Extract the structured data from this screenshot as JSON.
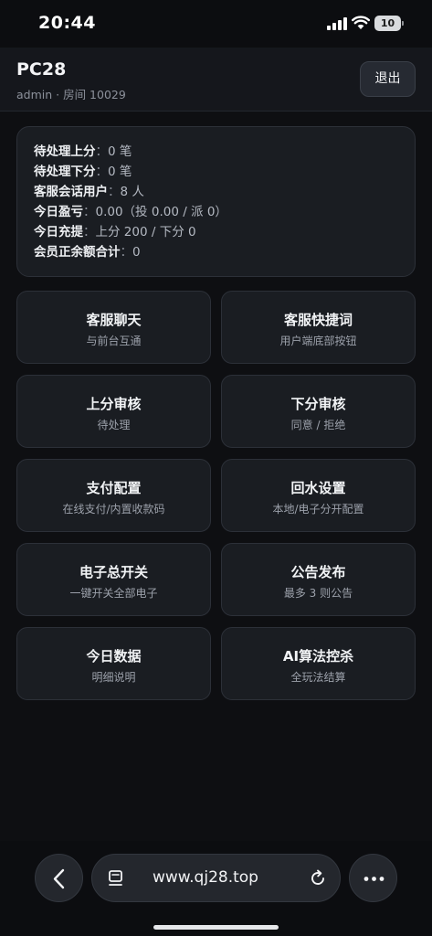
{
  "status_bar": {
    "time": "20:44",
    "battery": "10"
  },
  "header": {
    "title": "PC28",
    "subtitle": "admin · 房间 10029",
    "logout_label": "退出"
  },
  "stats": [
    {
      "label": "待处理上分",
      "value": "0 笔"
    },
    {
      "label": "待处理下分",
      "value": "0 笔"
    },
    {
      "label": "客服会话用户",
      "value": "8 人"
    },
    {
      "label": "今日盈亏",
      "value": "0.00（投 0.00 / 派 0）"
    },
    {
      "label": "今日充提",
      "value": "上分 200 / 下分 0"
    },
    {
      "label": "会员正余额合计",
      "value": "0"
    }
  ],
  "stat_separator": "：",
  "menu": [
    {
      "title": "客服聊天",
      "subtitle": "与前台互通"
    },
    {
      "title": "客服快捷词",
      "subtitle": "用户端底部按钮"
    },
    {
      "title": "上分审核",
      "subtitle": "待处理"
    },
    {
      "title": "下分审核",
      "subtitle": "同意 / 拒绝"
    },
    {
      "title": "支付配置",
      "subtitle": "在线支付/内置收款码"
    },
    {
      "title": "回水设置",
      "subtitle": "本地/电子分开配置"
    },
    {
      "title": "电子总开关",
      "subtitle": "一键开关全部电子"
    },
    {
      "title": "公告发布",
      "subtitle": "最多 3 则公告"
    },
    {
      "title": "今日数据",
      "subtitle": "明细说明"
    },
    {
      "title": "AI算法控杀",
      "subtitle": "全玩法结算"
    }
  ],
  "browser": {
    "url": "www.qj28.top",
    "icons": [
      "chevron-left-icon",
      "reader-icon",
      "reload-icon",
      "more-icon"
    ]
  }
}
